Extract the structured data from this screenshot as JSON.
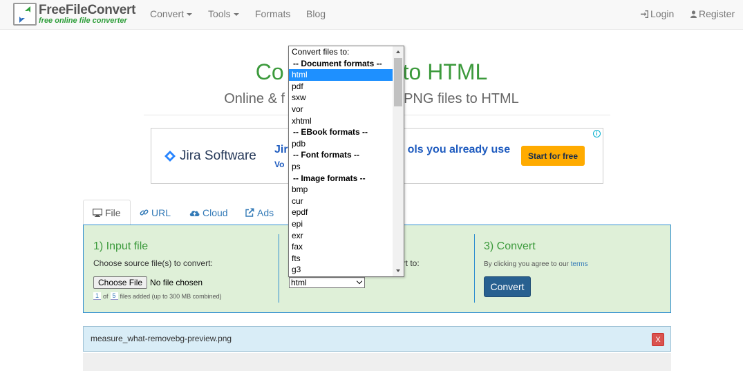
{
  "navbar": {
    "brand_name": "FreeFileConvert",
    "brand_tagline": "free online file converter",
    "convert_label": "Convert",
    "tools_label": "Tools",
    "formats_label": "Formats",
    "blog_label": "Blog",
    "login_label": "Login",
    "register_label": "Register"
  },
  "hero": {
    "title_left": "Co",
    "title_right": "to HTML",
    "subtitle_left": "Online & f",
    "subtitle_right": "PNG files to HTML"
  },
  "ad": {
    "brand": "Jira Software",
    "headline_left": "Jir",
    "headline_right": "ols you already use",
    "subline": "Vo",
    "cta": "Start for free"
  },
  "tabs": [
    {
      "label": "File",
      "icon": "monitor-icon",
      "active": true
    },
    {
      "label": "URL",
      "icon": "link-icon",
      "active": false
    },
    {
      "label": "Cloud",
      "icon": "cloud-upload-icon",
      "active": false
    },
    {
      "label": "Ads",
      "icon": "external-link-icon",
      "active": false
    }
  ],
  "step1": {
    "title": "1) Input file",
    "instruction": "Choose source file(s) to convert:",
    "choose_button": "Choose File",
    "no_file": "No file chosen",
    "count_current": "1",
    "count_of": "of",
    "count_max": "5",
    "count_suffix": "files added (up to 300 MB combined)"
  },
  "step2": {
    "instruction_tail": "ert to:",
    "selected_format": "html"
  },
  "step3": {
    "title": "3) Convert",
    "terms_prefix": "By clicking you agree to our",
    "terms_link": "terms",
    "convert_button": "Convert"
  },
  "file_item": {
    "name": "measure_what-removebg-preview.png",
    "remove_label": "X"
  },
  "dropdown": {
    "options": [
      {
        "label": "Convert files to:",
        "type": "header"
      },
      {
        "label": "-- Document formats --",
        "type": "group"
      },
      {
        "label": "html",
        "type": "option",
        "selected": true
      },
      {
        "label": "pdf",
        "type": "option"
      },
      {
        "label": "sxw",
        "type": "option"
      },
      {
        "label": "vor",
        "type": "option"
      },
      {
        "label": "xhtml",
        "type": "option"
      },
      {
        "label": "-- EBook formats --",
        "type": "group"
      },
      {
        "label": "pdb",
        "type": "option"
      },
      {
        "label": "-- Font formats --",
        "type": "group"
      },
      {
        "label": "ps",
        "type": "option"
      },
      {
        "label": "-- Image formats --",
        "type": "group"
      },
      {
        "label": "bmp",
        "type": "option"
      },
      {
        "label": "cur",
        "type": "option"
      },
      {
        "label": "epdf",
        "type": "option"
      },
      {
        "label": "epi",
        "type": "option"
      },
      {
        "label": "exr",
        "type": "option"
      },
      {
        "label": "fax",
        "type": "option"
      },
      {
        "label": "fts",
        "type": "option"
      },
      {
        "label": "g3",
        "type": "option"
      }
    ]
  },
  "colors": {
    "brand_green": "#3c9a3c",
    "link_blue": "#337ab7",
    "panel_bg": "#dff0d8",
    "panel_border": "#2e8ed0",
    "primary_button": "#286090",
    "danger": "#d9534f",
    "selection": "#1e90ff",
    "ad_cta": "#ffab00"
  }
}
